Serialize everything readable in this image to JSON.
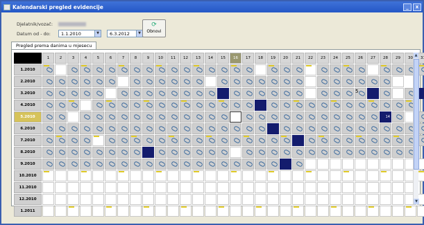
{
  "window": {
    "title": "Kalendarski pregled evidencije",
    "minimize": "_",
    "close": "x"
  },
  "filters": {
    "driver_label": "Djelatnik/vozač:",
    "date_label": "Datum od - do:",
    "date_from": "1.1.2010",
    "date_to": "6.3.2012"
  },
  "refresh_label": "Obnovi",
  "tab_label": "Pregled prema danima u mjesecu",
  "days": [
    "1",
    "2",
    "3",
    "4",
    "5",
    "6",
    "7",
    "8",
    "9",
    "10",
    "11",
    "12",
    "13",
    "14",
    "15",
    "16",
    "17",
    "18",
    "19",
    "20",
    "21",
    "22",
    "23",
    "24",
    "25",
    "26",
    "27",
    "28",
    "29",
    "30",
    "31"
  ],
  "today_day_index": 15,
  "current_month_index": 4,
  "months": [
    {
      "label": "1.2010",
      "cells": "gwgggggggggggggggwgggwggggwggggg"
    },
    {
      "label": "2.2010",
      "cells": "ggggggwggggggwgggggggwggggggw---"
    },
    {
      "label": "3.2010",
      "cells": "gggggwggggggggnggggggwggggngwgn"
    },
    {
      "label": "4.2010",
      "cells": "gggwgggggggggggggngggggggggggg-"
    },
    {
      "label": "5.2010",
      "cells": "ggwggggggggggggsgggggggggggngwg"
    },
    {
      "label": "6.2010",
      "cells": "ggggggggggggggggggngggggggggggg-"
    },
    {
      "label": "7.2010",
      "cells": "ggggwgggggggggggggggngggggggggg"
    },
    {
      "label": "8.2010",
      "cells": "ggggggggnggggggwgggggggggggggg"
    },
    {
      "label": "9.2010",
      "cells": "gggggggggggggggggggngwwwwwwwwww-"
    },
    {
      "label": "10.2010",
      "cells": "wwwwwwwwwwwwwwwwwwwwwwwwwwwwwww"
    },
    {
      "label": "11.2010",
      "cells": "wwwwwwwwwwwwwwwwwwwwwwwwwwwwww-"
    },
    {
      "label": "12.2010",
      "cells": "wwwwwwwwwwwwwwwwwwwwwwwwwwwwwww"
    },
    {
      "label": "1.2011",
      "cells": "wwwwwwwwwwwwwwwwwwwwwwwwwwwwwww"
    }
  ],
  "cell_badges": [
    {
      "month": 2,
      "day": 26,
      "text": "5"
    },
    {
      "month": 4,
      "day": 28,
      "text": "14"
    }
  ]
}
